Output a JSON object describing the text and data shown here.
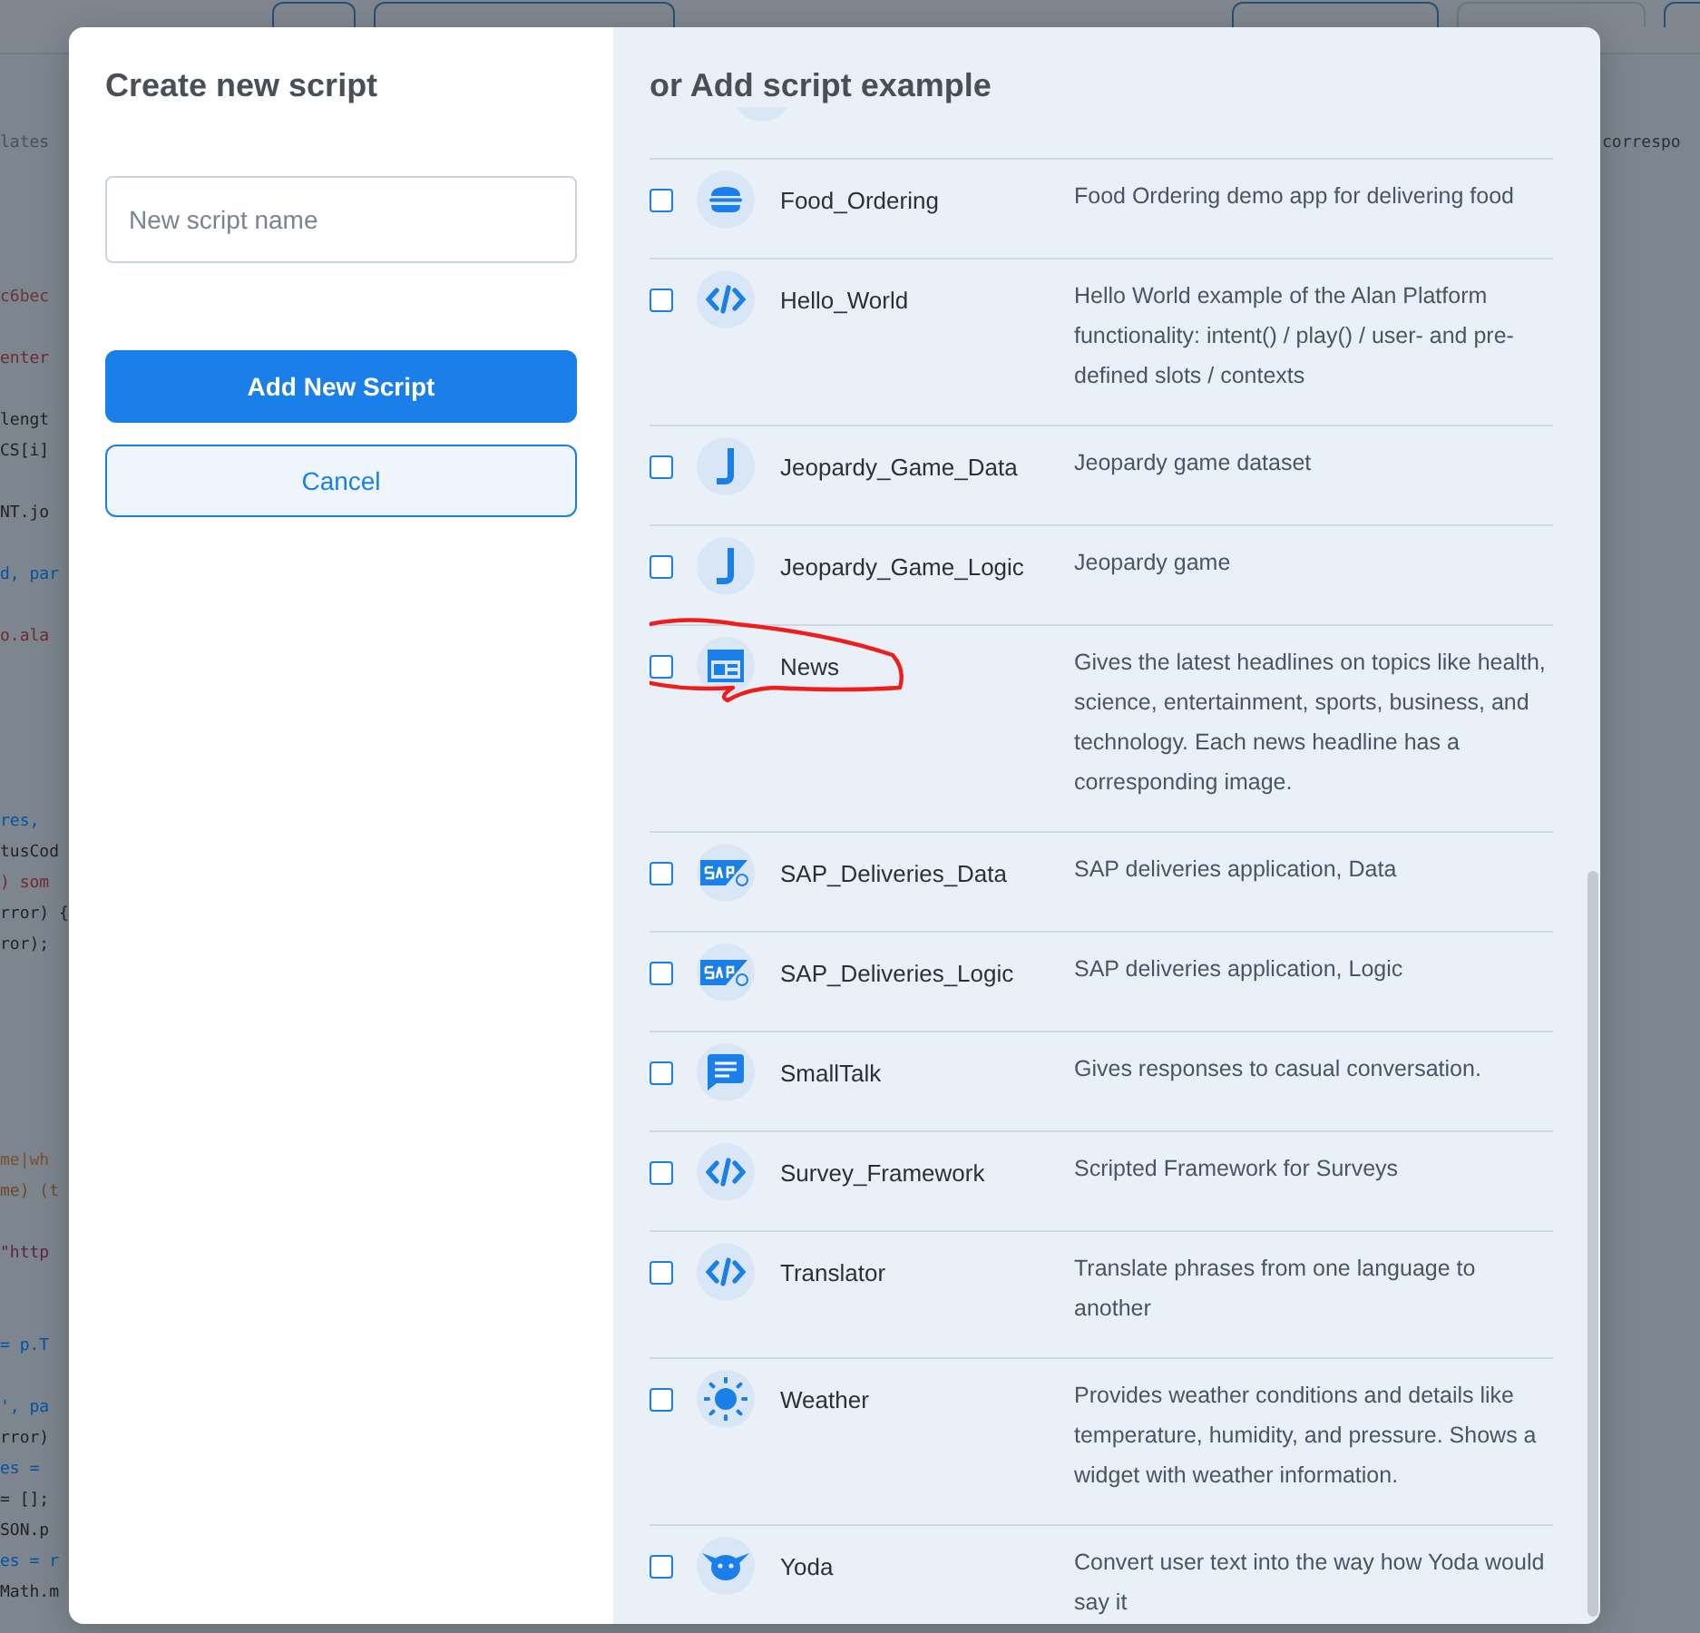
{
  "editor": {
    "right_text": "correspo",
    "lines": [
      {
        "kind": "code",
        "text": "lates",
        "color": "#4a5058"
      },
      {
        "kind": "blank"
      },
      {
        "kind": "blank"
      },
      {
        "kind": "blank"
      },
      {
        "kind": "blank"
      },
      {
        "kind": "code",
        "text": "c6bec",
        "color": "#6b3436"
      },
      {
        "kind": "blank"
      },
      {
        "kind": "code",
        "text": "enter",
        "color": "#6e2a2e"
      },
      {
        "kind": "blank"
      },
      {
        "kind": "code",
        "text": "lengt",
        "color": "#222222"
      },
      {
        "kind": "code",
        "text": "CS[i]",
        "color": "#222222"
      },
      {
        "kind": "blank"
      },
      {
        "kind": "code",
        "text": "NT.jo",
        "color": "#222222"
      },
      {
        "kind": "blank"
      },
      {
        "kind": "code",
        "text": "d, par",
        "color": "#0451a5"
      },
      {
        "kind": "blank"
      },
      {
        "kind": "code",
        "text": "o.ala",
        "color": "#6e2a2e"
      },
      {
        "kind": "blank"
      },
      {
        "kind": "blank"
      },
      {
        "kind": "blank"
      },
      {
        "kind": "blank"
      },
      {
        "kind": "blank"
      },
      {
        "kind": "code",
        "text": "res,",
        "color": "#0451a5"
      },
      {
        "kind": "code",
        "text": "tusCod",
        "color": "#222222"
      },
      {
        "kind": "code",
        "text": ") som",
        "color": "#6e2a2e"
      },
      {
        "kind": "code",
        "text": "rror) {",
        "color": "#222222"
      },
      {
        "kind": "code",
        "text": "ror);",
        "color": "#222222"
      },
      {
        "kind": "blank"
      },
      {
        "kind": "blank"
      },
      {
        "kind": "blank"
      },
      {
        "kind": "blank"
      },
      {
        "kind": "blank"
      },
      {
        "kind": "blank"
      },
      {
        "kind": "code",
        "text": "me|wh",
        "color": "#7a5030"
      },
      {
        "kind": "code",
        "text": "me) (t",
        "color": "#6b4a2a"
      },
      {
        "kind": "blank"
      },
      {
        "kind": "code",
        "text": "\"http",
        "color": "#5e2442"
      },
      {
        "kind": "blank"
      },
      {
        "kind": "blank"
      },
      {
        "kind": "code",
        "text": "= p.T",
        "color": "#0451a5"
      },
      {
        "kind": "blank"
      },
      {
        "kind": "code",
        "text": "', pa",
        "color": "#0451a5"
      },
      {
        "kind": "code",
        "text": "rror)",
        "color": "#222222"
      },
      {
        "kind": "code",
        "text": "es =",
        "color": "#0451a5"
      },
      {
        "kind": "code",
        "text": "= [];",
        "color": "#222222"
      },
      {
        "kind": "code",
        "text": "SON.p",
        "color": "#222222"
      },
      {
        "kind": "code",
        "text": "es = r",
        "color": "#0451a5"
      },
      {
        "kind": "code",
        "text": "Math.m",
        "color": "#222222"
      }
    ]
  },
  "dialog": {
    "create": {
      "title": "Create new script",
      "name_field": {
        "placeholder": "New script name"
      },
      "add_button": "Add New Script",
      "cancel_button": "Cancel"
    },
    "examples": {
      "title": "or Add script example",
      "items": [
        {
          "name": "Food_Ordering",
          "kind": "burger",
          "description": "Food Ordering demo app for delivering food",
          "checked": false,
          "circled": false
        },
        {
          "name": "Hello_World",
          "kind": "code",
          "description": "Hello World example of the Alan Platform functionality: intent() / play() / user- and pre-defined slots / contexts",
          "checked": false,
          "circled": false
        },
        {
          "name": "Jeopardy_Game_Data",
          "kind": "letter",
          "description": "Jeopardy game dataset",
          "checked": false,
          "circled": false
        },
        {
          "name": "Jeopardy_Game_Logic",
          "kind": "letter",
          "description": "Jeopardy game",
          "checked": false,
          "circled": false
        },
        {
          "name": "News",
          "kind": "news",
          "description": "Gives the latest headlines on topics like health, science, entertainment, sports, business, and technology. Each news headline has a corresponding image.",
          "checked": false,
          "circled": true
        },
        {
          "name": "SAP_Deliveries_Data",
          "kind": "sap",
          "description": "SAP deliveries application, Data",
          "checked": false,
          "circled": false
        },
        {
          "name": "SAP_Deliveries_Logic",
          "kind": "sap",
          "description": "SAP deliveries application, Logic",
          "checked": false,
          "circled": false
        },
        {
          "name": "SmallTalk",
          "kind": "chat",
          "description": "Gives responses to casual conversation.",
          "checked": false,
          "circled": false
        },
        {
          "name": "Survey_Framework",
          "kind": "code",
          "description": "Scripted Framework for Surveys",
          "checked": false,
          "circled": false
        },
        {
          "name": "Translator",
          "kind": "code",
          "description": "Translate phrases from one language to another",
          "checked": false,
          "circled": false
        },
        {
          "name": "Weather",
          "kind": "sun",
          "description": "Provides weather conditions and details like temperature, humidity, and pressure. Shows a widget with weather information.",
          "checked": false,
          "circled": false
        },
        {
          "name": "Yoda",
          "kind": "robot",
          "description": "Convert user text into the way how Yoda would say it",
          "checked": false,
          "circled": false
        }
      ]
    }
  }
}
